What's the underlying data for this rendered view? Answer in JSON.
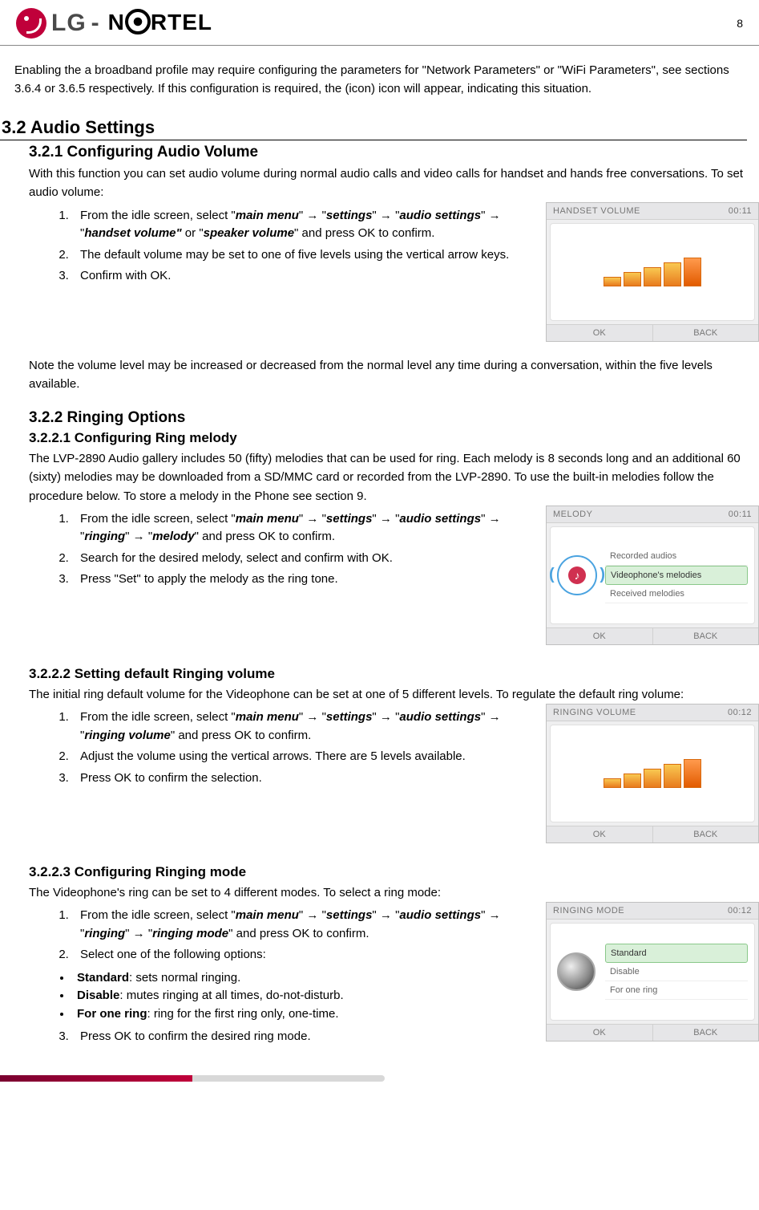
{
  "page_number": "8",
  "logo": {
    "brand1": "LG",
    "dash": "-",
    "brand2_pre": "N",
    "brand2_post": "RTEL"
  },
  "intro_para": "Enabling the a broadband profile may require configuring the parameters for \"Network Parameters\" or \"WiFi Parameters\", see sections 3.6.4 or 3.6.5 respectively.  If this configuration is required, the (icon) icon will appear, indicating this situation.",
  "sec32": "3.2    Audio Settings",
  "s321": {
    "heading": "3.2.1    Configuring Audio Volume",
    "intro": "With this function you can set audio volume during normal audio calls and video calls for handset and hands free conversations. To set audio volume:",
    "step1_a": "From the idle screen, select \"",
    "step1_b": "main menu",
    "step1_c": "\" → \"",
    "step1_d": "settings",
    "step1_e": "\" → \"",
    "step1_f": "audio settings",
    "step1_g": "\" → \"",
    "step1_h": "handset volume\"",
    "step1_i": " or \"",
    "step1_j": "speaker volume",
    "step1_k": "\" and press OK to confirm.",
    "step2": "The default volume may be set to one of five levels using the vertical arrow keys.",
    "step3": "Confirm with OK.",
    "note": "Note the volume level may be increased or decreased from the normal level any time during a conversation, within the five levels available.",
    "fig": {
      "title": "HANDSET VOLUME",
      "time": "00:11",
      "ok": "OK",
      "back": "BACK"
    }
  },
  "s322": {
    "heading": "3.2.2    Ringing Options"
  },
  "s3221": {
    "heading": "3.2.2.1    Configuring Ring melody",
    "intro": "The LVP-2890 Audio gallery includes 50 (fifty) melodies that can be used for ring.  Each melody is 8 seconds long and an additional 60 (sixty) melodies may be downloaded from a SD/MMC card or recorded from the LVP-2890.  To use the built-in melodies follow the procedure below.  To store a melody in the Phone see section 9.",
    "step1_a": "From the idle screen, select \"",
    "step1_b": "main menu",
    "step1_c": "\" → \"",
    "step1_d": "settings",
    "step1_e": "\" → \"",
    "step1_f": "audio settings",
    "step1_g": "\" → \"",
    "step1_h": "ringing",
    "step1_i": "\" → \"",
    "step1_j": "melody",
    "step1_k": "\" and press OK to confirm.",
    "step2": "Search for the desired melody, select and confirm with OK.",
    "step3": "Press \"Set\" to apply the melody as the ring tone.",
    "fig": {
      "title": "MELODY",
      "time": "00:11",
      "opt1": "Recorded audios",
      "opt2": "Videophone's melodies",
      "opt3": "Received melodies",
      "ok": "OK",
      "back": "BACK"
    }
  },
  "s3222": {
    "heading": "3.2.2.2    Setting default Ringing volume",
    "intro": "The initial ring default volume for the Videophone can be set at one of 5 different levels. To regulate the default ring volume:",
    "step1_a": "From the idle screen, select \"",
    "step1_b": "main menu",
    "step1_c": "\" → \"",
    "step1_d": "settings",
    "step1_e": "\" → \"",
    "step1_f": "audio settings",
    "step1_g": "\" → \"",
    "step1_h": "ringing volume",
    "step1_i": "\" and press OK to confirm.",
    "step2": "Adjust the volume using the vertical arrows.  There are 5 levels available.",
    "step3": "Press OK to confirm the selection.",
    "fig": {
      "title": "RINGING VOLUME",
      "time": "00:12",
      "ok": "OK",
      "back": "BACK"
    }
  },
  "s3223": {
    "heading": "3.2.2.3    Configuring Ringing mode",
    "intro": "The Videophone's ring can be set to 4 different modes. To select a ring mode:",
    "step1_a": "From the idle screen, select \"",
    "step1_b": "main menu",
    "step1_c": "\" → \"",
    "step1_d": "settings",
    "step1_e": "\" → \"",
    "step1_f": "audio settings",
    "step1_g": "\" → \"",
    "step1_h": "ringing",
    "step1_i": "\" → \"",
    "step1_j": "ringing mode",
    "step1_k": "\" and press OK to confirm.",
    "step2": "Select one of the following options:",
    "b1a": "Standard",
    "b1b": ": sets normal ringing.",
    "b2a": "Disable",
    "b2b": ": mutes ringing at all times, do-not-disturb.",
    "b3a": "For one ring",
    "b3b": ": ring for the first ring only, one-time.",
    "step3": "Press OK to confirm the desired ring mode.",
    "fig": {
      "title": "RINGING MODE",
      "time": "00:12",
      "opt1": "Standard",
      "opt2": "Disable",
      "opt3": "For one ring",
      "ok": "OK",
      "back": "BACK"
    }
  }
}
